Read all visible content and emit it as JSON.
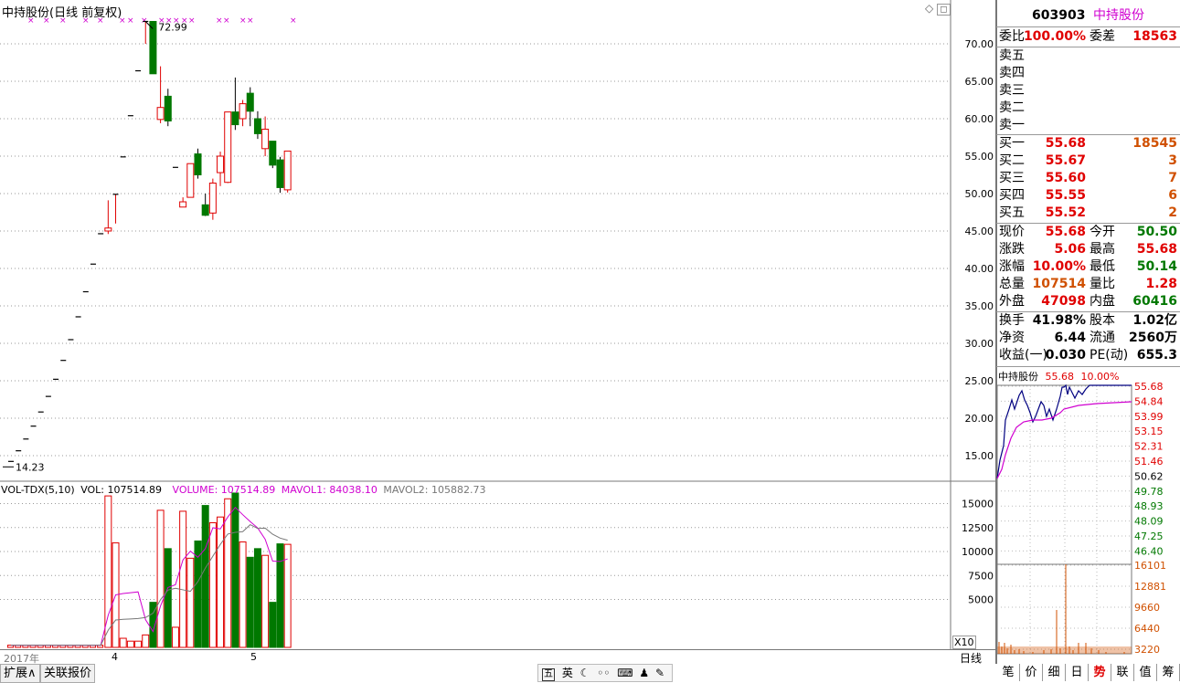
{
  "chart_title": "中持股份(日线 前复权)",
  "max_label": "72.99",
  "min_label": "14.23",
  "price_axis": [
    "70.00",
    "65.00",
    "60.00",
    "55.00",
    "50.00",
    "45.00",
    "40.00",
    "35.00",
    "30.00",
    "25.00",
    "20.00",
    "15.00"
  ],
  "vol_axis": [
    "15000",
    "12500",
    "10000",
    "7500",
    "5000"
  ],
  "vol_unit": "X10",
  "volume_header": {
    "name": "VOL-TDX(5,10)",
    "vol": "VOL: 107514.89",
    "volume": "VOLUME: 107514.89",
    "mavol1": "MAVOL1: 84038.10",
    "mavol2": "MAVOL2: 105882.73"
  },
  "date_axis": {
    "year": "2017年",
    "m4": "4",
    "m5": "5"
  },
  "period_label": "日线",
  "quote": {
    "code": "603903",
    "name": "中持股份",
    "weibi_label": "委比",
    "weibi": "100.00%",
    "weicha_label": "委差",
    "weicha": "18563",
    "sells": [
      {
        "label": "卖五"
      },
      {
        "label": "卖四"
      },
      {
        "label": "卖三"
      },
      {
        "label": "卖二"
      },
      {
        "label": "卖一"
      }
    ],
    "buys": [
      {
        "label": "买一",
        "price": "55.68",
        "vol": "18545"
      },
      {
        "label": "买二",
        "price": "55.67",
        "vol": "3"
      },
      {
        "label": "买三",
        "price": "55.60",
        "vol": "7"
      },
      {
        "label": "买四",
        "price": "55.55",
        "vol": "6"
      },
      {
        "label": "买五",
        "price": "55.52",
        "vol": "2"
      }
    ],
    "stats": [
      {
        "l1": "现价",
        "v1": "55.68",
        "c1": "red",
        "l2": "今开",
        "v2": "50.50",
        "c2": "green"
      },
      {
        "l1": "涨跌",
        "v1": "5.06",
        "c1": "red",
        "l2": "最高",
        "v2": "55.68",
        "c2": "red"
      },
      {
        "l1": "涨幅",
        "v1": "10.00%",
        "c1": "red",
        "l2": "最低",
        "v2": "50.14",
        "c2": "green"
      },
      {
        "l1": "总量",
        "v1": "107514",
        "c1": "orange",
        "l2": "量比",
        "v2": "1.28",
        "c2": "red"
      },
      {
        "l1": "外盘",
        "v1": "47098",
        "c1": "red",
        "l2": "内盘",
        "v2": "60416",
        "c2": "green"
      }
    ],
    "stats2": [
      {
        "l1": "换手",
        "v1": "41.98%",
        "l2": "股本",
        "v2": "1.02亿"
      },
      {
        "l1": "净资",
        "v1": "6.44",
        "l2": "流通",
        "v2": "2560万"
      },
      {
        "l1": "收益(一)",
        "v1": "0.030",
        "l2": "PE(动)",
        "v2": "655.3"
      }
    ]
  },
  "mini": {
    "name": "中持股份",
    "price": "55.68",
    "pct": "10.00%",
    "price_axis_up": [
      "55.68",
      "54.84",
      "53.99",
      "53.15",
      "52.31",
      "51.46"
    ],
    "price_axis_mid": "50.62",
    "price_axis_down": [
      "49.78",
      "48.93",
      "48.09",
      "47.25",
      "46.40"
    ],
    "vol_axis": [
      "16101",
      "12881",
      "9660",
      "6440",
      "3220"
    ]
  },
  "right_tabs": [
    "笔",
    "价",
    "细",
    "日",
    "势",
    "联",
    "值",
    "筹"
  ],
  "bottom_tabs": [
    "扩展∧",
    "关联报价"
  ],
  "taskbar": [
    "五",
    "英"
  ],
  "chart_data": {
    "type": "candlestick",
    "title": "中持股份(日线 前复权)",
    "ylim": [
      12,
      74
    ],
    "max_marker": 72.99,
    "min_marker": 14.23,
    "ohlc": [
      {
        "o": 14.23,
        "h": 14.23,
        "l": 14.23,
        "c": 14.23
      },
      {
        "o": 15.65,
        "h": 15.65,
        "l": 15.65,
        "c": 15.65
      },
      {
        "o": 17.22,
        "h": 17.22,
        "l": 17.22,
        "c": 17.22
      },
      {
        "o": 18.94,
        "h": 18.94,
        "l": 18.94,
        "c": 18.94
      },
      {
        "o": 20.83,
        "h": 20.83,
        "l": 20.83,
        "c": 20.83
      },
      {
        "o": 22.91,
        "h": 22.91,
        "l": 22.91,
        "c": 22.91
      },
      {
        "o": 25.2,
        "h": 25.2,
        "l": 25.2,
        "c": 25.2
      },
      {
        "o": 27.72,
        "h": 27.72,
        "l": 27.72,
        "c": 27.72
      },
      {
        "o": 30.49,
        "h": 30.49,
        "l": 30.49,
        "c": 30.49
      },
      {
        "o": 33.54,
        "h": 33.54,
        "l": 33.54,
        "c": 33.54
      },
      {
        "o": 36.89,
        "h": 36.89,
        "l": 36.89,
        "c": 36.89
      },
      {
        "o": 40.58,
        "h": 40.58,
        "l": 40.58,
        "c": 40.58
      },
      {
        "o": 44.64,
        "h": 44.64,
        "l": 44.64,
        "c": 44.64
      },
      {
        "o": 45.0,
        "h": 49.1,
        "l": 44.6,
        "c": 45.4
      },
      {
        "o": 49.9,
        "h": 49.9,
        "l": 46.0,
        "c": 49.9
      },
      {
        "o": 54.9,
        "h": 54.9,
        "l": 54.9,
        "c": 54.9
      },
      {
        "o": 60.4,
        "h": 60.4,
        "l": 60.4,
        "c": 60.4
      },
      {
        "o": 66.4,
        "h": 66.4,
        "l": 66.4,
        "c": 66.4
      },
      {
        "o": 72.99,
        "h": 72.99,
        "l": 70.0,
        "c": 72.99
      },
      {
        "o": 72.99,
        "h": 72.99,
        "l": 66.0,
        "c": 66.0
      },
      {
        "o": 59.9,
        "h": 67.0,
        "l": 59.4,
        "c": 61.5
      },
      {
        "o": 63.0,
        "h": 64.0,
        "l": 59.0,
        "c": 59.7
      },
      {
        "o": 53.5,
        "h": 53.5,
        "l": 53.5,
        "c": 53.5
      },
      {
        "o": 48.2,
        "h": 49.5,
        "l": 48.2,
        "c": 48.9
      },
      {
        "o": 49.5,
        "h": 54.0,
        "l": 49.5,
        "c": 54.0
      },
      {
        "o": 55.3,
        "h": 56.0,
        "l": 52.0,
        "c": 52.5
      },
      {
        "o": 48.5,
        "h": 50.0,
        "l": 47.0,
        "c": 47.1
      },
      {
        "o": 47.4,
        "h": 52.0,
        "l": 46.5,
        "c": 51.4
      },
      {
        "o": 52.8,
        "h": 55.6,
        "l": 51.0,
        "c": 55.0
      },
      {
        "o": 51.5,
        "h": 60.9,
        "l": 51.4,
        "c": 60.9
      },
      {
        "o": 60.9,
        "h": 65.5,
        "l": 58.5,
        "c": 59.2
      },
      {
        "o": 60.0,
        "h": 62.5,
        "l": 59.0,
        "c": 62.0
      },
      {
        "o": 63.4,
        "h": 64.2,
        "l": 59.0,
        "c": 61.0
      },
      {
        "o": 60.0,
        "h": 61.0,
        "l": 57.3,
        "c": 58.0
      },
      {
        "o": 56.0,
        "h": 60.3,
        "l": 55.0,
        "c": 58.6
      },
      {
        "o": 57.0,
        "h": 57.0,
        "l": 53.4,
        "c": 53.8
      },
      {
        "o": 54.5,
        "h": 54.9,
        "l": 50.1,
        "c": 50.8
      },
      {
        "o": 50.5,
        "h": 55.68,
        "l": 50.14,
        "c": 55.68
      }
    ],
    "volume": [
      230,
      230,
      230,
      230,
      230,
      230,
      230,
      230,
      230,
      230,
      230,
      230,
      230,
      15800,
      10900,
      950,
      650,
      650,
      1300,
      4700,
      14300,
      10300,
      2100,
      14200,
      9300,
      11100,
      14800,
      13000,
      13600,
      15500,
      16100,
      11000,
      9400,
      10300,
      9600,
      4700,
      10800,
      10750
    ]
  }
}
